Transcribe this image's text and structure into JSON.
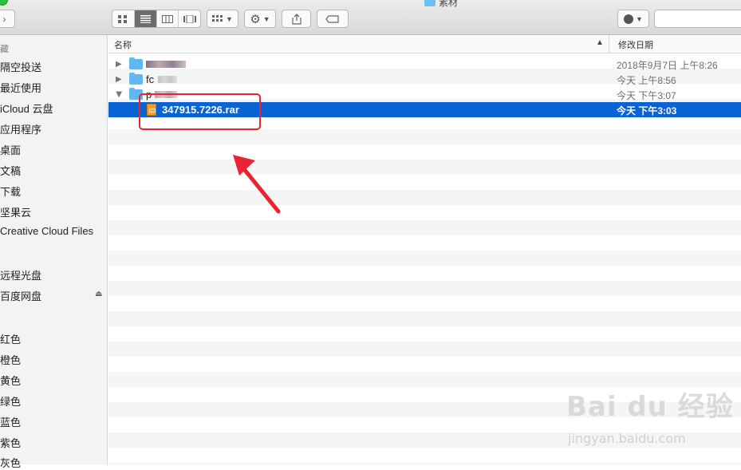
{
  "window": {
    "title": "素材"
  },
  "toolbar": {
    "view_icons": [
      "grid-view-icon",
      "list-view-icon",
      "column-view-icon",
      "cover-flow-icon"
    ],
    "arrange_icon": "arrange-icon",
    "action_icon": "gear-icon",
    "share_icon": "share-icon",
    "tag_icon": "tag-icon",
    "app_icon": "app-icon"
  },
  "sidebar": {
    "heading": "藏",
    "favorites": [
      "隔空投送",
      "最近使用",
      "iCloud 云盘",
      "应用程序",
      "桌面",
      "文稿",
      "下载",
      "坚果云",
      "Creative Cloud Files"
    ],
    "devices": [
      "远程光盘",
      "百度网盘"
    ],
    "tags": [
      "红色",
      "橙色",
      "黄色",
      "绿色",
      "蓝色",
      "紫色",
      "灰色"
    ]
  },
  "columns": {
    "name": "名称",
    "date_modified": "修改日期"
  },
  "files": [
    {
      "name": "",
      "date": "2018年9月7日 上午8:26",
      "expanded": false,
      "type": "folder"
    },
    {
      "name": "fc",
      "date": "今天 上午8:56",
      "expanded": false,
      "type": "folder"
    },
    {
      "name": "p",
      "date": "今天 下午3:07",
      "expanded": true,
      "type": "folder"
    },
    {
      "name": "347915.7226.rar",
      "date": "今天 下午3:03",
      "type": "rar",
      "selected": true
    }
  ],
  "colors": {
    "selection": "#0a63d3",
    "annotation": "#ea2330",
    "folder": "#5fb8ef"
  },
  "watermark": {
    "main": "Bai du 经验",
    "sub": "jingyan.baidu.com"
  }
}
